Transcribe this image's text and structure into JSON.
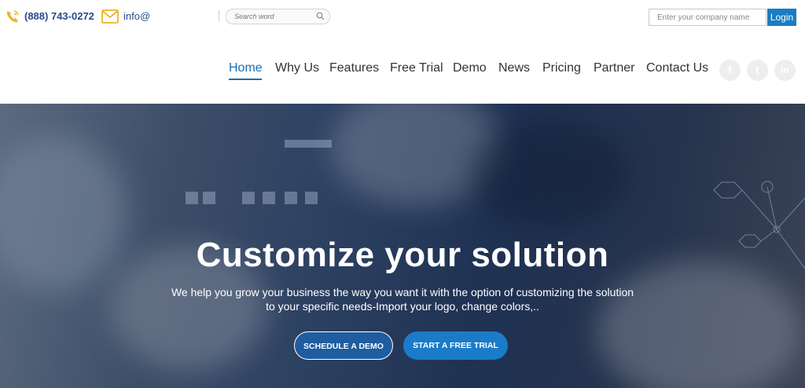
{
  "topbar": {
    "phone": "(888) 743-0272",
    "email": "info@",
    "search_placeholder": "Search word",
    "company_placeholder": "Enter your company name",
    "login_label": "Login"
  },
  "nav": {
    "items": [
      "Home",
      "Why Us",
      "Features",
      "Free Trial",
      "Demo",
      "News",
      "Pricing",
      "Partner",
      "Contact Us"
    ],
    "active": "Home"
  },
  "social": {
    "facebook": "f",
    "twitter": "t",
    "linkedin": "in"
  },
  "hero": {
    "title": "Customize your solution",
    "subtitle_line1": "We help you grow your business the way you want it with the option of customizing the solution",
    "subtitle_line2": "to your specific needs-Import your logo, change colors,..",
    "btn_demo": "SCHEDULE A DEMO",
    "btn_trial": "START A FREE TRIAL"
  },
  "colors": {
    "accent": "#1a7cc2",
    "nav_active": "#1a6fb2",
    "icon_yellow": "#f0b323",
    "hero_bg": "#2d4162"
  }
}
